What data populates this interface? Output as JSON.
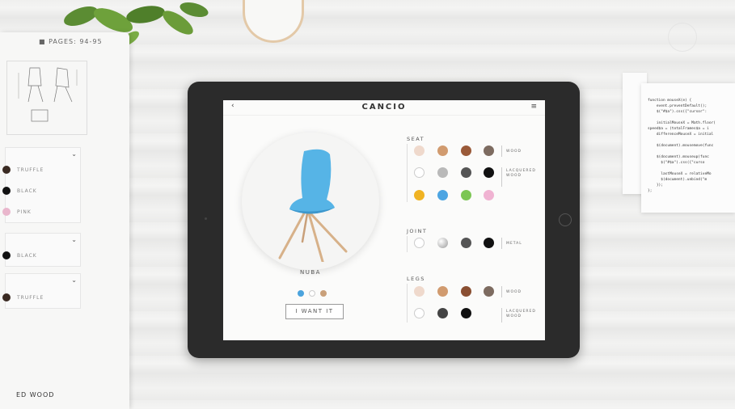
{
  "paper": {
    "title": "PAGES: 94-95",
    "cards": [
      {
        "rows": [
          {
            "label": "TRUFFLE",
            "color": "#3a2a22"
          },
          {
            "label": "BLACK",
            "color": "#111111"
          },
          {
            "label": "PINK",
            "color": "#e9b6cc"
          }
        ]
      },
      {
        "rows": [
          {
            "label": "BLACK",
            "color": "#111111"
          }
        ]
      },
      {
        "rows": [
          {
            "label": "TRUFFLE",
            "color": "#3a2a22"
          }
        ]
      }
    ],
    "footer_label": "ED WOOD"
  },
  "code_card": {
    "text": "function mouseX(e) {\n    event.preventDefault();\n    $(\"#$a\").css({\"cursor\":\n\n    initialMouseX = Math.floor(\nspeed$a = (totalFrames$a = i\n    differenceMouseX = initial\n\n    $(document).mousemove(func\n\n    $(document).mouseup(func\n      $(\"#$a\").css({\"curso\n\n      lastMouseX = relativeMo\n      $(document).unbind(\"m\n    });\n};"
  },
  "app": {
    "brand": "CANCIO",
    "back_icon": "chevron-left-icon",
    "menu_icon": "hamburger-icon",
    "product_name": "NUBA",
    "cta_label": "I WANT IT",
    "variant_colors": [
      "#4ba3dd",
      "#ffffff",
      "#c9a07a"
    ],
    "chair_color": "#56b4e6",
    "leg_color": "#d7b189",
    "sections": [
      {
        "label": "SEAT",
        "groups": [
          {
            "material": "WOOD",
            "colors": [
              "#efd9cc",
              "#d19b6f",
              "#9a5a39",
              "#7d6b60"
            ]
          },
          {
            "material": "LACQUERED WOOD",
            "colors": [
              "#ffffff",
              "#b9b9b9",
              "#555555",
              "#111111",
              "#f0b323",
              "#4da5e2",
              "#7cc654",
              "#f0b3d2"
            ]
          }
        ]
      },
      {
        "label": "JOINT",
        "groups": [
          {
            "material": "METAL",
            "colors": [
              "#ffffff",
              "#c8c8c8",
              "#555555",
              "#111111"
            ]
          }
        ]
      },
      {
        "label": "LEGS",
        "groups": [
          {
            "material": "WOOD",
            "colors": [
              "#efd9cc",
              "#d19b6f",
              "#8a4f32",
              "#7d6b60"
            ]
          },
          {
            "material": "LACQUERED WOOD",
            "colors": [
              "#ffffff",
              "#444444",
              "#111111"
            ]
          }
        ]
      }
    ]
  }
}
